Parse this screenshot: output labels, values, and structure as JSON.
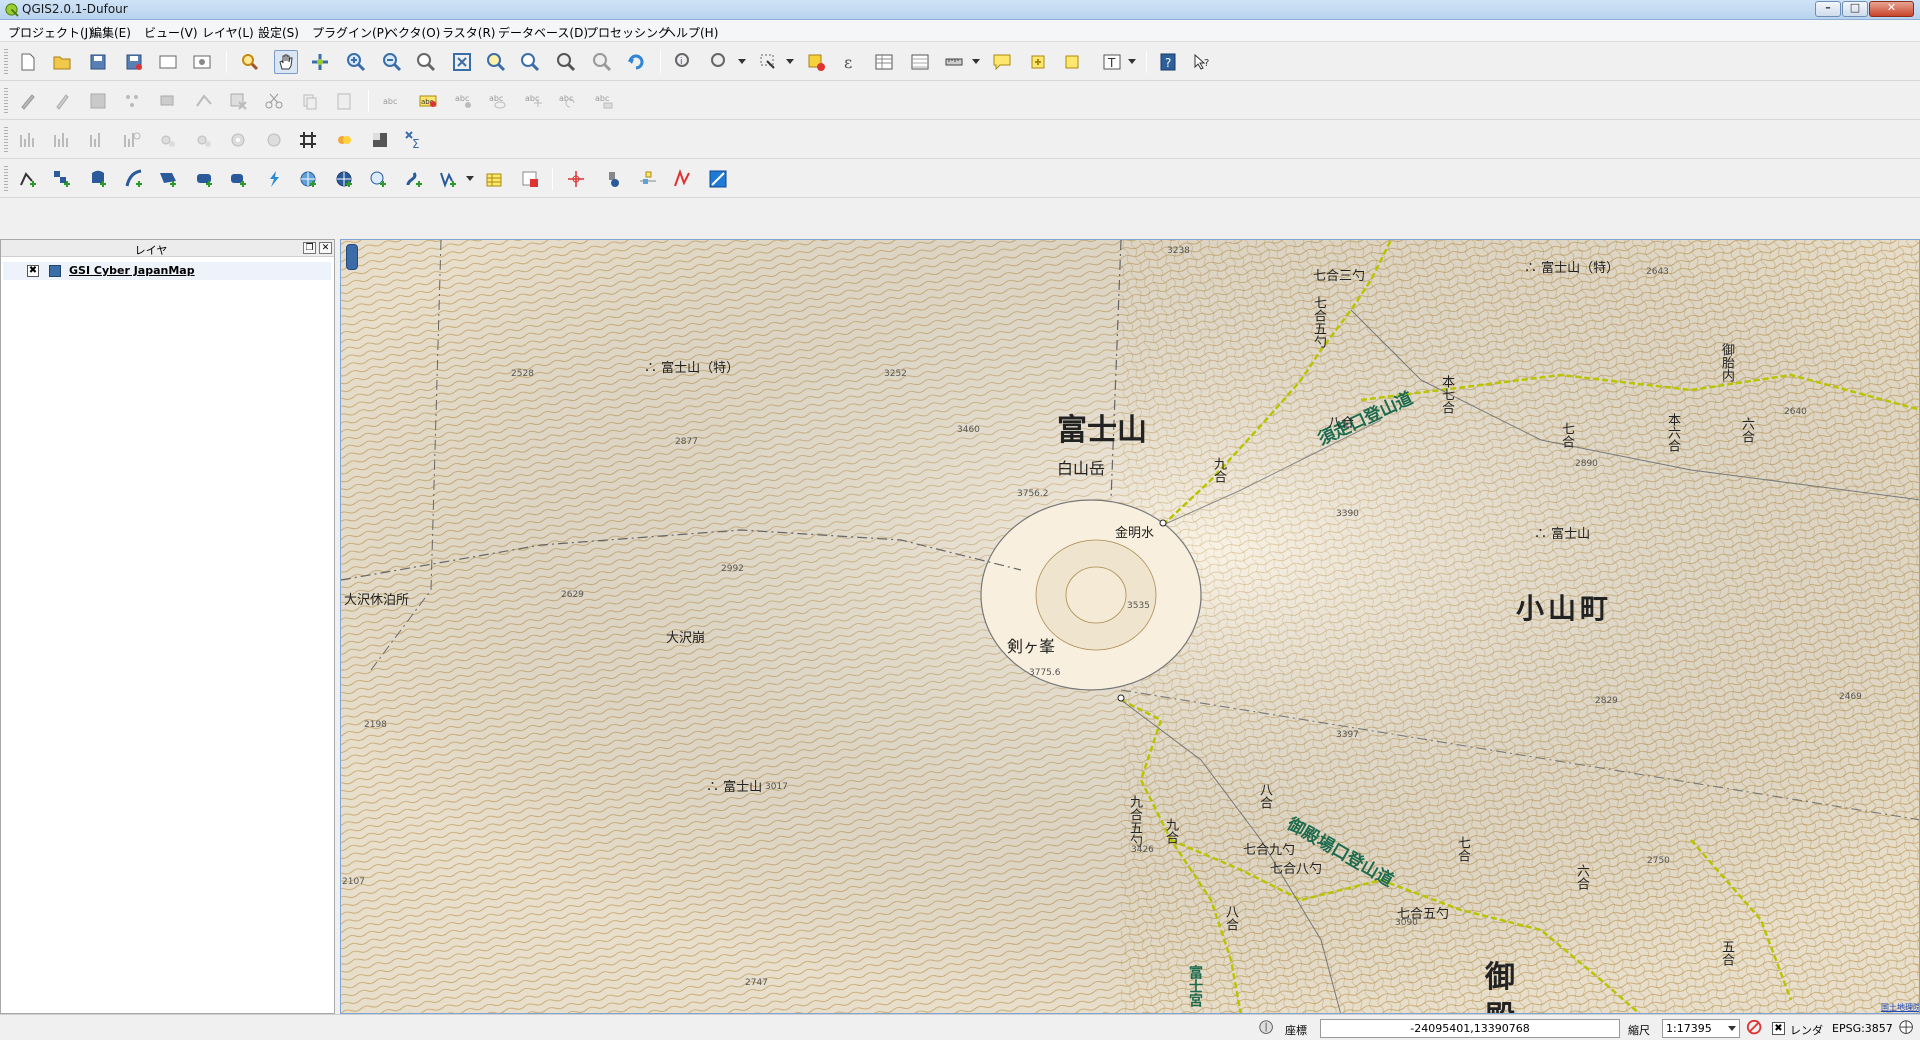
{
  "window": {
    "title": "QGIS2.0.1-Dufour",
    "minimize": "–",
    "maximize": "□",
    "close": "✕"
  },
  "menu": [
    "プロジェクト(J)",
    "編集(E)",
    "ビュー(V)",
    "レイヤ(L)",
    "設定(S)",
    "プラグイン(P)",
    "ベクタ(O)",
    "ラスタ(R)",
    "データベース(D)",
    "プロセッシング",
    "ヘルプ(H)"
  ],
  "toolbars": {
    "file": [
      "new-project",
      "open-project",
      "save-project",
      "save-as",
      "new-print-composer",
      "composer-manager"
    ],
    "navigation": [
      "pan-map-to-selection",
      "pan",
      "touch-zoom",
      "zoom-in",
      "zoom-out",
      "zoom-actual",
      "zoom-full",
      "zoom-to-selection",
      "zoom-to-layer",
      "zoom-last",
      "zoom-next",
      "refresh"
    ],
    "attributes": [
      "identify",
      "select",
      "select-by-freehand",
      "deselect",
      "expression-select",
      "attribute-table",
      "field-calculator",
      "measure",
      "map-tips",
      "new-bookmark",
      "show-bookmarks",
      "text-annotation",
      "help-contents",
      "whats-this"
    ],
    "active_tool": "pan"
  },
  "layers_panel": {
    "title": "レイヤ",
    "layers": [
      {
        "name": "GSI Cyber JapanMap",
        "checked": "✖"
      }
    ]
  },
  "map": {
    "labels": {
      "fuji_main": "富士山",
      "hakusan": "白山岳",
      "kinmeisui": "金明水",
      "kengamine": "剣ヶ峯",
      "oyama": "小山町",
      "osawa_hut": "大沢休泊所",
      "osawa_kuzure": "大沢崩",
      "fuji_toku_left": "∴ 富士山（特）",
      "fuji_toku_right": "∴ 富士山（特）",
      "fuji_right": "∴ 富士山",
      "fuji_lower": "∴ 富士山",
      "subashiri_trail": "須走口登山道",
      "gotemba_trail": "御殿場口登山道",
      "nanago_sanshaku": "七合三勺",
      "hachigo": "八合",
      "kyugo": "九合",
      "honnanago": "本七合",
      "nanago": "七合",
      "rokugo": "六合",
      "honrokugo": "本六合",
      "gotaimei": "御胎内",
      "nanago_goshaku": "七合五勺",
      "kyugo_goshaku": "九合五勺",
      "kyugo2": "九合",
      "hachigo2": "八合",
      "nanago_kyushaku": "七合九勺",
      "nanago_hasshaku": "七合八勺",
      "nanago2": "七合",
      "rokugo2": "六合",
      "nanago_goshaku2": "七合五勺",
      "hachigo3": "八合",
      "gogo": "五合",
      "fujinomiya": "富士宮",
      "go": "御",
      "den": "殿",
      "credit": "国土地理院"
    },
    "elevations": [
      "3238",
      "2643",
      "2528",
      "3252",
      "2877",
      "3460",
      "3756.2",
      "3390",
      "2890",
      "2640",
      "2992",
      "2629",
      "3535",
      "3775.6",
      "3397",
      "2829",
      "2469",
      "2198",
      "3017",
      "2107",
      "2747",
      "2750",
      "3090",
      "3426"
    ]
  },
  "statusbar": {
    "coord_label": "座標",
    "coord_value": "-24095401,13390768",
    "scale_label": "縮尺",
    "scale_value": "1:17395",
    "render_label": "レンダ",
    "render_checked": "✖",
    "crs": "EPSG:3857"
  },
  "colors": {
    "map_bg": "#f6ecd8",
    "contour": "#c8a35a",
    "trail": "#b9c400",
    "trail_text": "#1d6b4e",
    "accent": "#3d6ba8"
  }
}
